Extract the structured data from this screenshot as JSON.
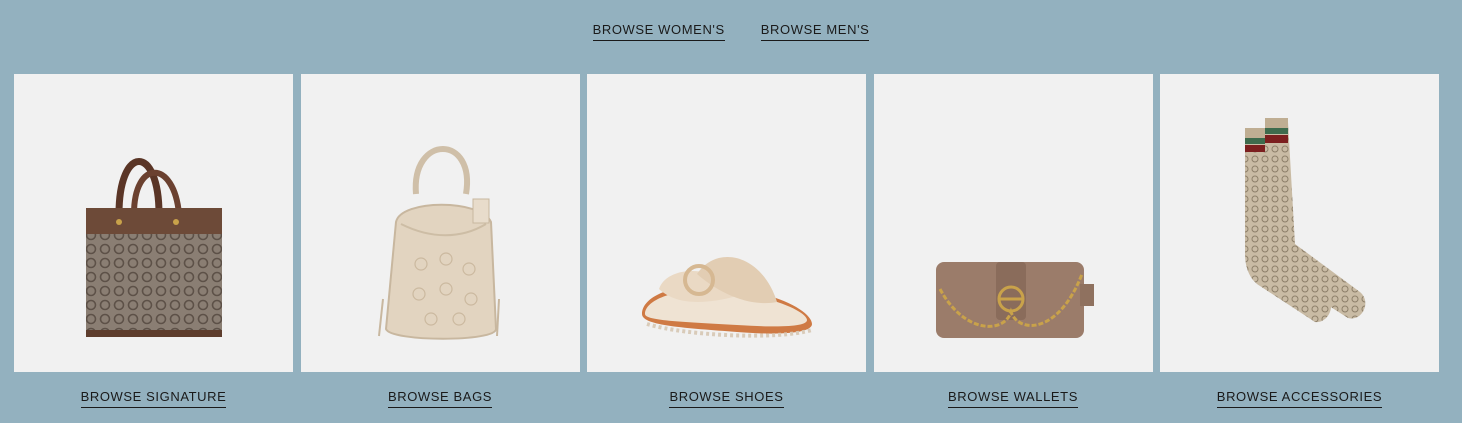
{
  "top_nav": {
    "women_label": "BROWSE WOMEN'S",
    "men_label": "BROWSE MEN'S"
  },
  "categories": [
    {
      "label": "BROWSE SIGNATURE",
      "icon": "signature-tote-icon"
    },
    {
      "label": "BROWSE BAGS",
      "icon": "bucket-bag-icon"
    },
    {
      "label": "BROWSE SHOES",
      "icon": "shearling-sandal-icon"
    },
    {
      "label": "BROWSE WALLETS",
      "icon": "chain-crossbody-icon"
    },
    {
      "label": "BROWSE ACCESSORIES",
      "icon": "signature-socks-icon"
    }
  ],
  "colors": {
    "background": "#93b1bf",
    "tile": "#f1f1f1",
    "text": "#1a1a1a"
  }
}
